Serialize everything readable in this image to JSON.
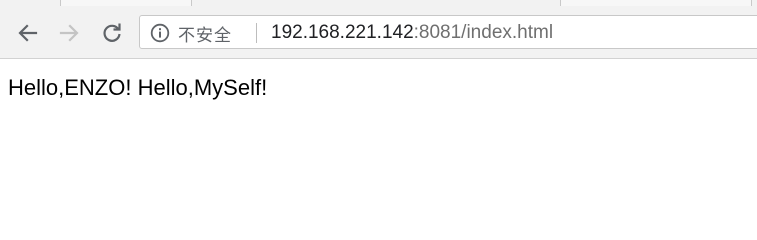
{
  "browser": {
    "nav": {
      "back_icon": "arrow-left-icon",
      "forward_icon": "arrow-right-icon",
      "reload_icon": "reload-icon"
    },
    "omnibox": {
      "security_icon": "info-circle-icon",
      "security_label": "不安全",
      "url_host": "192.168.221.142",
      "url_rest": ":8081/index.html"
    }
  },
  "page": {
    "body_text": "Hello,ENZO! Hello,MySelf!"
  },
  "colors": {
    "toolbar_bg": "#f2f2f2",
    "icon_active": "#5f6368",
    "icon_disabled": "#c4c4c4",
    "url_host": "#202124",
    "url_rest": "#6f6f6f"
  }
}
